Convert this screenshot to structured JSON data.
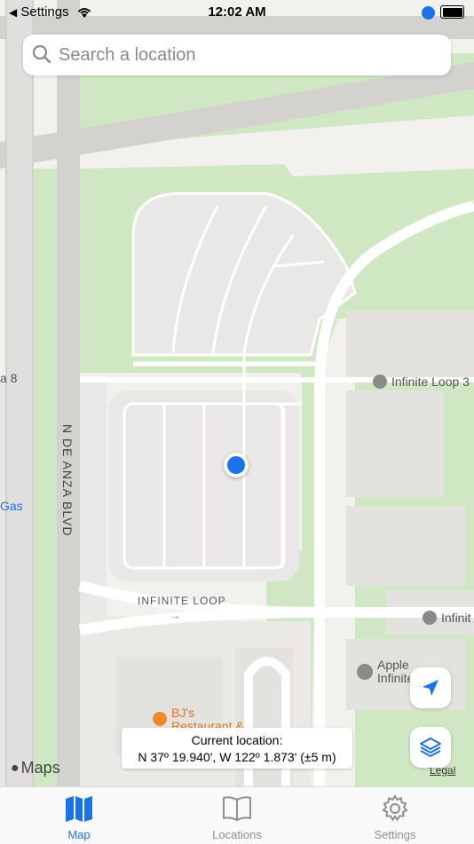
{
  "status_bar": {
    "back_label": "Settings",
    "time": "12:02 AM"
  },
  "search": {
    "placeholder": "Search a location"
  },
  "map": {
    "street_labels": {
      "de_anza": "N DE ANZA BLVD",
      "infinite_loop": "INFINITE LOOP"
    },
    "poi": {
      "infinite_loop_3": "Infinite Loop 3",
      "infinite_right": "Infinit",
      "apple_line1": "Apple",
      "apple_line2": "Infinite Loop",
      "bjs_line1": "BJ's",
      "bjs_line2": "Restaurant &",
      "gas": "Gas",
      "edge_8": "a 8"
    },
    "attribution": "Maps",
    "legal": "Legal"
  },
  "current_location": {
    "title": "Current location:",
    "coords": "N 37º 19.940', W 122º 1.873' (±5 m)"
  },
  "tabs": [
    {
      "label": "Map",
      "icon": "map-icon",
      "active": true
    },
    {
      "label": "Locations",
      "icon": "book-icon",
      "active": false
    },
    {
      "label": "Settings",
      "icon": "gear-icon",
      "active": false
    }
  ],
  "colors": {
    "accent": "#1a73e8",
    "green": "#cfe8c3",
    "road": "#ffffff",
    "block": "#e9e8e6"
  }
}
